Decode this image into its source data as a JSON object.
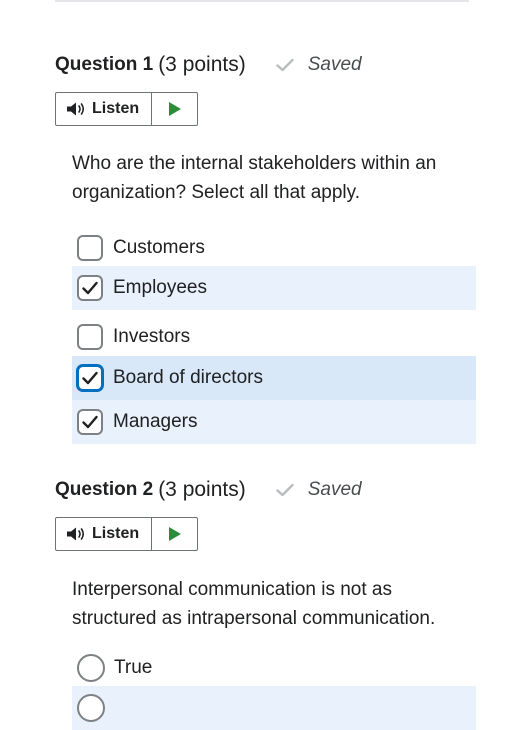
{
  "questions": [
    {
      "number_label": "Question 1",
      "points_label": "(3 points)",
      "status": "Saved",
      "listen_label": "Listen",
      "text": "Who are the internal stakeholders within an organization? Select all that apply.",
      "type": "checkbox",
      "options": [
        {
          "label": "Customers",
          "checked": false
        },
        {
          "label": "Employees",
          "checked": true
        },
        {
          "label": "Investors",
          "checked": false
        },
        {
          "label": "Board of directors",
          "checked": true
        },
        {
          "label": "Managers",
          "checked": true
        }
      ]
    },
    {
      "number_label": "Question 2",
      "points_label": "(3 points)",
      "status": "Saved",
      "listen_label": "Listen",
      "text": "Interpersonal communication is not as structured as intrapersonal communication.",
      "type": "radio",
      "options": [
        {
          "label": "True",
          "checked": false
        },
        {
          "label": "",
          "checked": true
        }
      ]
    }
  ],
  "colors": {
    "selected_row": "#e8f1fc",
    "focused_row": "#d9e8f8",
    "focus_ring": "#006fbf",
    "play_green": "#2e8b3a",
    "saved_check": "#b9bcbe"
  },
  "icons": {
    "saved": "check-icon",
    "listen": "speaker-icon",
    "play": "play-icon",
    "checkbox_checked": "checkmark-icon"
  }
}
